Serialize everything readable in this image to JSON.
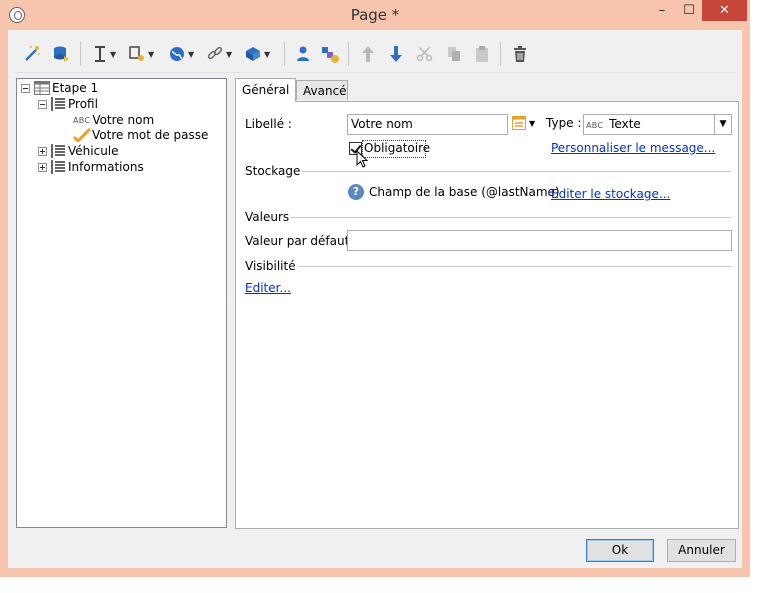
{
  "window": {
    "title": "Page *",
    "controls": {
      "minimize": "–",
      "maximize": "☐",
      "close": "✕"
    }
  },
  "tree": {
    "nodes": [
      {
        "label": "Etape 1",
        "icon": "table-icon"
      },
      {
        "label": "Profil",
        "icon": "list-icon"
      },
      {
        "label": "Votre nom",
        "icon": "abc-text-icon",
        "icon_text": "ABC"
      },
      {
        "label": "Votre mot de passe",
        "icon": "password-check-icon"
      },
      {
        "label": "Véhicule",
        "icon": "list-icon"
      },
      {
        "label": "Informations",
        "icon": "list-icon"
      }
    ]
  },
  "tabs": [
    {
      "label": "Général"
    },
    {
      "label": "Avancé"
    }
  ],
  "general": {
    "libelle_label": "Libellé :",
    "libelle_value": "Votre nom",
    "type_label": "Type :",
    "type_icon_text": "ABC",
    "type_value": "Texte",
    "obligatoire_label": "Obligatoire",
    "personnaliser_link": "Personnaliser le message...",
    "stockage_title": "Stockage",
    "storage_text": "Champ de la base (@lastName)",
    "editer_stockage_link": "Editer le stockage...",
    "valeurs_title": "Valeurs",
    "defaut_label": "Valeur par défaut :",
    "defaut_value": "",
    "visibilite_title": "Visibilité",
    "editer_link": "Editer..."
  },
  "buttons": {
    "ok": "Ok",
    "annuler": "Annuler"
  },
  "colors": {
    "frame": "#f7c5ad",
    "close": "#c7463a",
    "link": "#0033cc",
    "accent_blue": "#2d6fc4"
  }
}
